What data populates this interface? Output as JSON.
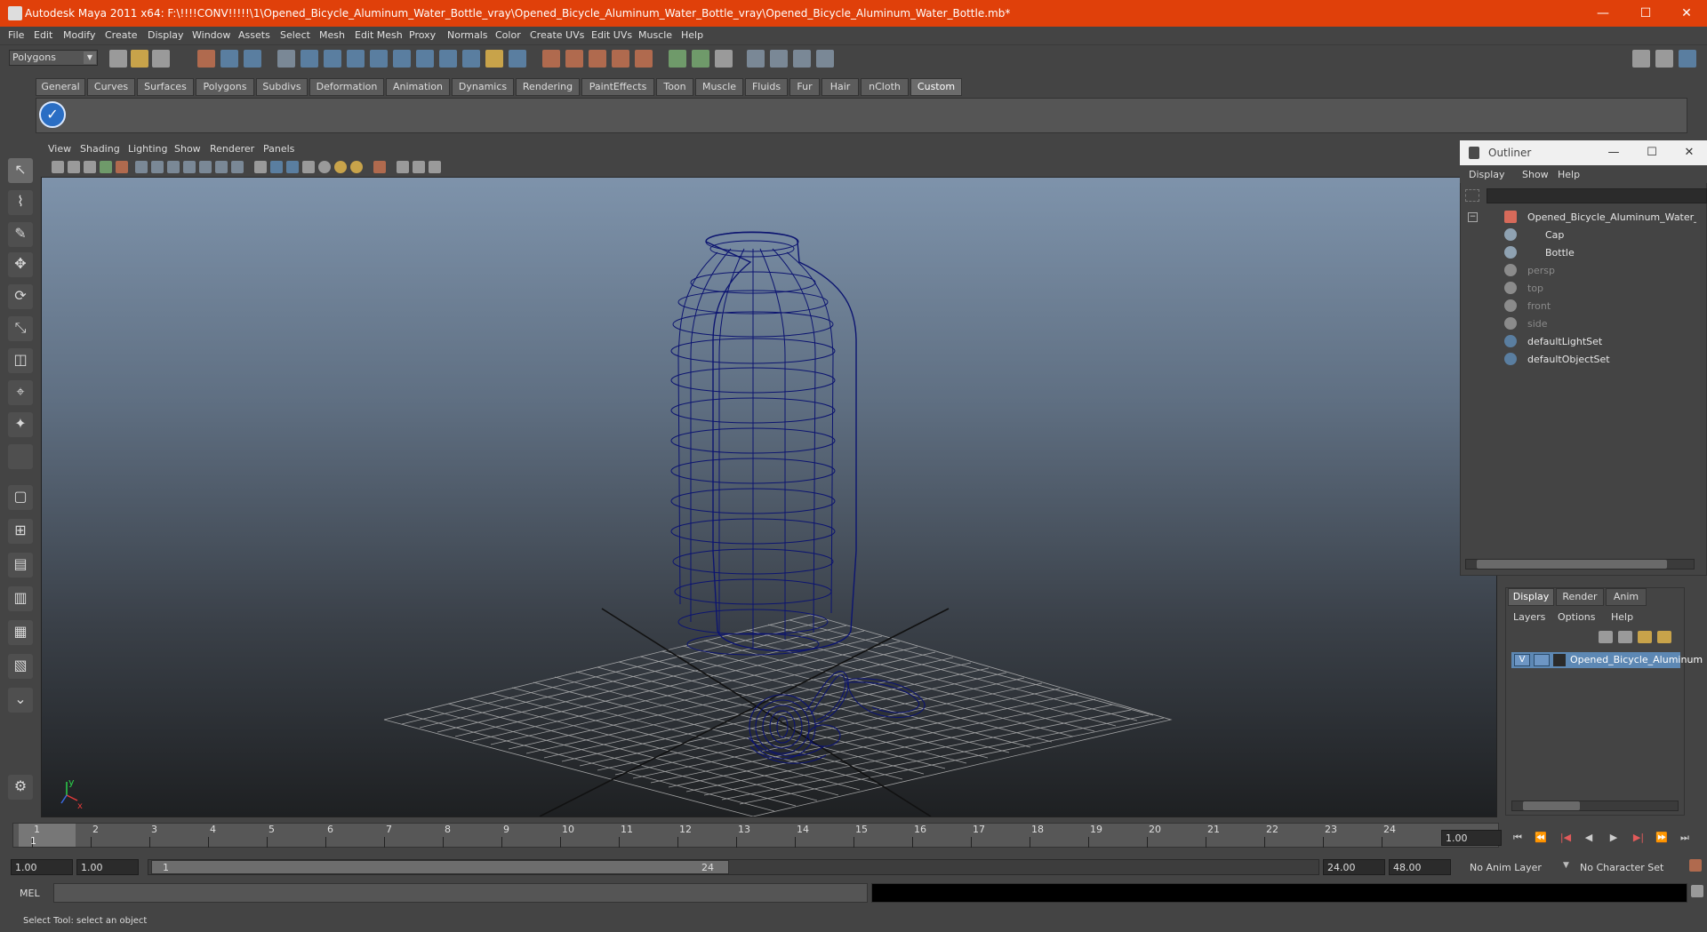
{
  "window": {
    "title": "Autodesk Maya 2011 x64: F:\\!!!!CONV!!!!!\\1\\Opened_Bicycle_Aluminum_Water_Bottle_vray\\Opened_Bicycle_Aluminum_Water_Bottle_vray\\Opened_Bicycle_Aluminum_Water_Bottle.mb*",
    "minimize": "—",
    "maximize": "☐",
    "close": "✕"
  },
  "menus": [
    "File",
    "Edit",
    "Modify",
    "Create",
    "Display",
    "Window",
    "Assets",
    "Select",
    "Mesh",
    "Edit Mesh",
    "Proxy",
    "Normals",
    "Color",
    "Create UVs",
    "Edit UVs",
    "Muscle",
    "Help"
  ],
  "status_line": {
    "mode": "Polygons"
  },
  "shelf": {
    "tabs": [
      "General",
      "Curves",
      "Surfaces",
      "Polygons",
      "Subdivs",
      "Deformation",
      "Animation",
      "Dynamics",
      "Rendering",
      "PaintEffects",
      "Toon",
      "Muscle",
      "Fluids",
      "Fur",
      "Hair",
      "nCloth",
      "Custom"
    ],
    "active_tab": "Custom",
    "item_glyph": "✓"
  },
  "viewport": {
    "menus": [
      "View",
      "Shading",
      "Lighting",
      "Show",
      "Renderer",
      "Panels"
    ],
    "axis_y": "y",
    "axis_x": "x"
  },
  "outliner": {
    "title": "Outliner",
    "menus": [
      "Display",
      "Show",
      "Help"
    ],
    "items": [
      {
        "label": "Opened_Bicycle_Aluminum_Water_Bottl",
        "indent": 0,
        "dim": false
      },
      {
        "label": "Cap",
        "indent": 1,
        "dim": false
      },
      {
        "label": "Bottle",
        "indent": 1,
        "dim": false
      },
      {
        "label": "persp",
        "indent": 0,
        "dim": true
      },
      {
        "label": "top",
        "indent": 0,
        "dim": true
      },
      {
        "label": "front",
        "indent": 0,
        "dim": true
      },
      {
        "label": "side",
        "indent": 0,
        "dim": true
      },
      {
        "label": "defaultLightSet",
        "indent": 0,
        "dim": false
      },
      {
        "label": "defaultObjectSet",
        "indent": 0,
        "dim": false
      }
    ]
  },
  "layer_editor": {
    "tabs": [
      "Display",
      "Render",
      "Anim"
    ],
    "active_tab": "Display",
    "menus": [
      "Layers",
      "Options",
      "Help"
    ],
    "layer": {
      "visible": "V",
      "name": "Opened_Bicycle_Aluminum"
    }
  },
  "time_slider": {
    "ticks": [
      "1",
      "2",
      "3",
      "4",
      "5",
      "6",
      "7",
      "8",
      "9",
      "10",
      "11",
      "12",
      "13",
      "14",
      "15",
      "16",
      "17",
      "18",
      "19",
      "20",
      "21",
      "22",
      "23",
      "24"
    ],
    "current_time": "1.00",
    "playback_buttons": [
      "⏮",
      "⏪",
      "|◀",
      "◀",
      "▶",
      "▶|",
      "⏩",
      "⏭"
    ]
  },
  "range_slider": {
    "start_time": "1.00",
    "playback_start": "1.00",
    "range_start_label": "1",
    "range_end_label": "24",
    "playback_end": "24.00",
    "end_time": "48.00",
    "anim_layer": "No Anim Layer",
    "character_set": "No Character Set"
  },
  "command_line": {
    "label": "MEL"
  },
  "help_line": {
    "text": "Select Tool: select an object"
  }
}
